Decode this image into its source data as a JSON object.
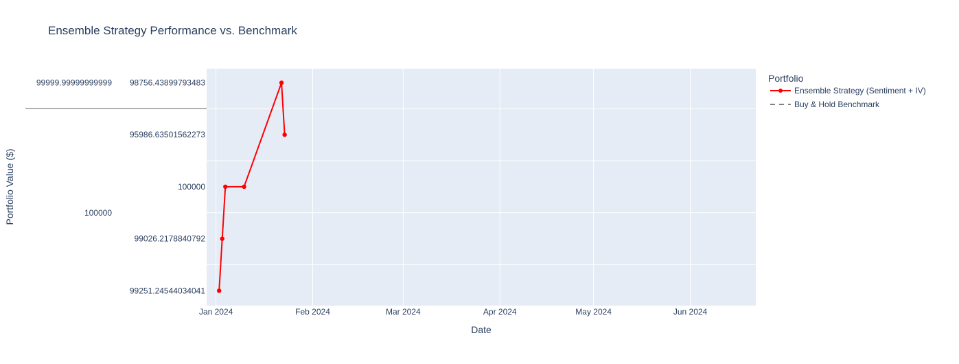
{
  "chart_data": {
    "type": "line",
    "title": "Ensemble Strategy Performance vs. Benchmark",
    "xlabel": "Date",
    "ylabel": "Portfolio Value ($)",
    "x_ticks": [
      "Jan 2024",
      "Feb 2024",
      "Mar 2024",
      "Apr 2024",
      "May 2024",
      "Jun 2024"
    ],
    "y_ticks": [
      "99251.24544034041",
      "99026.2178840792",
      "100000",
      "95986.63501562273",
      "98756.43899793483"
    ],
    "benchmark_axis_ticks": [
      "99999.99999999999",
      "100000"
    ],
    "legend_title": "Portfolio",
    "legend_position": "right",
    "grid": true,
    "series": [
      {
        "name": "Ensemble Strategy (Sentiment + IV)",
        "color": "#ff0000",
        "style": "lines+markers",
        "x": [
          "2024-01-02",
          "2024-01-03",
          "2024-01-04",
          "2024-01-10",
          "2024-01-22",
          "2024-01-23"
        ],
        "y": [
          "99251.24544034041",
          "99026.2178840792",
          "100000",
          "100000",
          "98756.43899793483",
          "95986.63501562273"
        ]
      },
      {
        "name": "Buy & Hold Benchmark",
        "color": "#808080",
        "style": "dash",
        "y": [
          "99999.99999999999"
        ]
      }
    ]
  }
}
